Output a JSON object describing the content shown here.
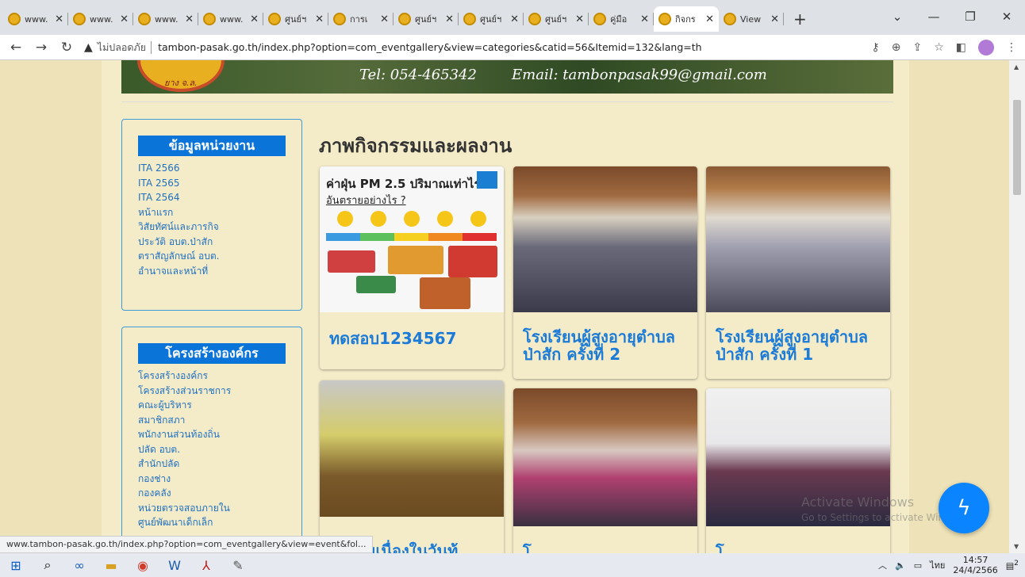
{
  "browser": {
    "tabs": [
      {
        "title": "www."
      },
      {
        "title": "www."
      },
      {
        "title": "www."
      },
      {
        "title": "www."
      },
      {
        "title": "ศูนย์ฯ"
      },
      {
        "title": "การเ"
      },
      {
        "title": "ศูนย์ฯ"
      },
      {
        "title": "ศูนย์ฯ"
      },
      {
        "title": "ศูนย์ฯ"
      },
      {
        "title": "คู่มือ"
      },
      {
        "title": "กิจกร"
      },
      {
        "title": "View"
      }
    ],
    "insecure_label": "ไม่ปลอดภัย",
    "url": "tambon-pasak.go.th/index.php?option=com_eventgallery&view=categories&catid=56&Itemid=132&lang=th",
    "status_url": "www.tambon-pasak.go.th/index.php?option=com_eventgallery&view=event&fol..."
  },
  "banner": {
    "tel": "Tel: 054-465342",
    "email": "Email: tambonpasak99@gmail.com",
    "seal_text": "ยาง จ.ล."
  },
  "sidebar": {
    "box1": {
      "title": "ข้อมูลหน่วยงาน",
      "items": [
        "ITA 2566",
        "ITA 2565",
        "ITA 2564",
        "หน้าแรก",
        "วิสัยทัศน์และภารกิจ",
        "ประวัติ อบต.ป่าสัก",
        "ตราสัญลักษณ์ อบต.",
        "อำนาจและหน้าที่"
      ]
    },
    "box2": {
      "title": "โครงสร้างองค์กร",
      "items": [
        "โครงสร้างองค์กร",
        "โครงสร้างส่วนราชการ",
        "คณะผู้บริหาร",
        "สมาชิกสภา",
        "พนักงานส่วนท้องถิ่น",
        "ปลัด อบต.",
        "สำนักปลัด",
        "กองช่าง",
        "กองคลัง",
        "หน่วยตรวจสอบภายใน",
        "ศูนย์พัฒนาเด็กเล็ก"
      ]
    }
  },
  "main": {
    "title": "ภาพกิจกรรมและผลงาน",
    "cards": [
      {
        "title": "ทดสอบ1234567"
      },
      {
        "title": "โรงเรียนผู้สูงอายุตำบลป่าสัก ครั้งที่ 2"
      },
      {
        "title": "โรงเรียนผู้สูงอายุตำบลป่าสัก ครั้งที่ 1"
      },
      {
        "title": "จกรรมเนื่องในวันท้"
      },
      {
        "title": "โ"
      },
      {
        "title": "โ"
      }
    ],
    "pm_image": {
      "heading": "ค่าฝุ่น PM 2.5 ปริมาณเท่าไร",
      "subheading": "อันตรายอย่างไร ?"
    }
  },
  "overlay": {
    "watermark1": "Activate Windows",
    "watermark2": "Go to Settings to activate Windows."
  },
  "taskbar": {
    "lang": "ไทย",
    "time": "14:57",
    "date": "24/4/2566",
    "notif_count": "2"
  }
}
